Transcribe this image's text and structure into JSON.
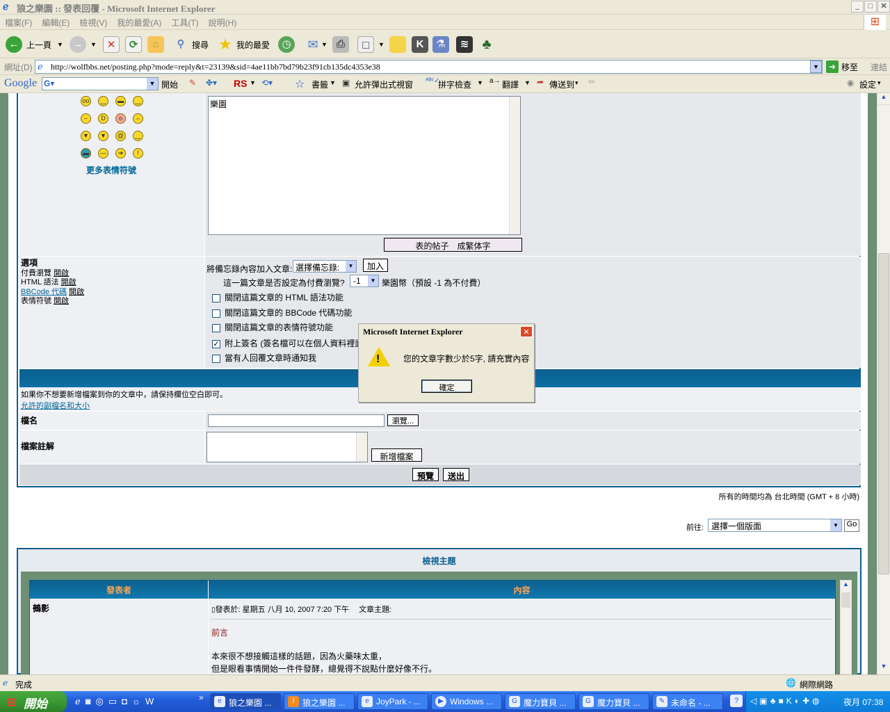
{
  "window": {
    "title": "狼之樂園 :: 發表回覆 - Microsoft Internet Explorer"
  },
  "menu": [
    "檔案(F)",
    "編輯(E)",
    "檢視(V)",
    "我的最愛(A)",
    "工具(T)",
    "說明(H)"
  ],
  "toolbar": {
    "back": "上一頁",
    "search": "搜尋",
    "favorites": "我的最愛"
  },
  "address": {
    "label": "網址(D)",
    "url": "http://wolfbbs.net/posting.php?mode=reply&t=23139&sid=4ae11bb7bd79b23f91cb135dc4353e38",
    "go": "移至",
    "links": "連結"
  },
  "google": {
    "logo": "Google",
    "start": "開始",
    "bookmarks": "書籤",
    "popup": "允許彈出式視窗",
    "spell": "拼字檢查",
    "translate": "翻譯",
    "send": "傳送到",
    "settings": "設定",
    "rs": "RS"
  },
  "form": {
    "more_emoticons": "更多表情符號",
    "textarea_text": "樂園",
    "convert_buttons": "表的帖子　成繁体字",
    "options_title": "選項",
    "opt_pay": "付費瀏覽",
    "opt_html": "HTML 語法",
    "opt_bbcode": "BBCode 代碼",
    "opt_smilies": "表情符號",
    "on": "開啟",
    "memo_label": "將備忘錄內容加入文章:",
    "memo_select": "選擇備忘錄:",
    "memo_add": "加入",
    "pay_label": "這一篇文章是否設定為付費瀏覽?",
    "pay_value": "-1",
    "pay_suffix": "樂園幣（預設 -1 為不付費）",
    "cb_html": "關閉這篇文章的 HTML 語法功能",
    "cb_bbcode": "關閉這篇文章的 BBCode 代碼功能",
    "cb_smilies": "關閉這篇文章的表情符號功能",
    "cb_sig": "附上簽名 (簽名檔可以在個人資料裡面",
    "cb_notify": "當有人回覆文章時通知我",
    "attach_note": "如果你不想要新增檔案到你的文章中，請保持欄位空白即可。",
    "attach_ext": "允許的副檔名和大小",
    "filename": "檔名",
    "browse": "瀏覽...",
    "file_comment": "檔案註解",
    "add_file": "新增檔案",
    "preview": "預覽",
    "submit": "送出",
    "timezone": "所有的時間均為 台北時間 (GMT + 8 小時)",
    "jump_label": "前往:",
    "jump_select": "選擇一個版面",
    "go": "Go"
  },
  "topic": {
    "header": "檢視主題",
    "col_author": "發表者",
    "col_content": "內容",
    "author": "鵺影",
    "posted": "發表於: 星期五 八月 10, 2007 7:20 下午　 文章主題:",
    "subject": "前言",
    "line1": "本來很不想接觸這樣的話題，因為火藥味太重，",
    "line2": "但是眼看事情開始一件件發酵，總覺得不說點什麼好像不行。"
  },
  "dialog": {
    "title": "Microsoft Internet Explorer",
    "message": "您的文章字數少於5字, 請充實內容",
    "ok": "確定"
  },
  "status": {
    "text": "完成",
    "zone": "網際網路"
  },
  "taskbar": {
    "start": "開始",
    "tasks": [
      "狼之樂園 ...",
      "狼之樂園 ...",
      "JoyPark - ...",
      "Windows ...",
      "魔力寶貝 ...",
      "魔力寶貝 ...",
      "未命名 - ..."
    ],
    "clock": "夜月 07:38"
  },
  "colors": {
    "forum_header": "#0b5f8f",
    "forum_blue": "#006699",
    "taskbar": "#245edb",
    "start": "#3c9a32"
  }
}
